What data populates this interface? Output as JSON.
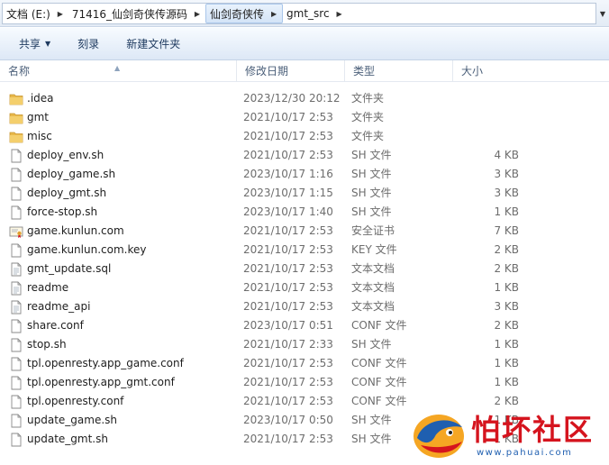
{
  "address_bar": {
    "crumbs": [
      {
        "label": "文档 (E:)"
      },
      {
        "label": "71416_仙剑奇侠传源码"
      },
      {
        "label": "仙剑奇侠传"
      },
      {
        "label": "gmt_src"
      }
    ]
  },
  "toolbar": {
    "organize_label": "共享",
    "burn_label": "刻录",
    "new_folder_label": "新建文件夹"
  },
  "columns": {
    "name": "名称",
    "date": "修改日期",
    "type": "类型",
    "size": "大小"
  },
  "files": [
    {
      "name": ".idea",
      "date": "2023/12/30 20:12",
      "type": "文件夹",
      "size": "",
      "icon": "folder-icon"
    },
    {
      "name": "gmt",
      "date": "2021/10/17 2:53",
      "type": "文件夹",
      "size": "",
      "icon": "folder-icon"
    },
    {
      "name": "misc",
      "date": "2021/10/17 2:53",
      "type": "文件夹",
      "size": "",
      "icon": "folder-icon"
    },
    {
      "name": "deploy_env.sh",
      "date": "2021/10/17 2:53",
      "type": "SH 文件",
      "size": "4 KB",
      "icon": "file-icon"
    },
    {
      "name": "deploy_game.sh",
      "date": "2023/10/17 1:16",
      "type": "SH 文件",
      "size": "3 KB",
      "icon": "file-icon"
    },
    {
      "name": "deploy_gmt.sh",
      "date": "2023/10/17 1:15",
      "type": "SH 文件",
      "size": "3 KB",
      "icon": "file-icon"
    },
    {
      "name": "force-stop.sh",
      "date": "2023/10/17 1:40",
      "type": "SH 文件",
      "size": "1 KB",
      "icon": "file-icon"
    },
    {
      "name": "game.kunlun.com",
      "date": "2021/10/17 2:53",
      "type": "安全证书",
      "size": "7 KB",
      "icon": "certificate-icon"
    },
    {
      "name": "game.kunlun.com.key",
      "date": "2021/10/17 2:53",
      "type": "KEY 文件",
      "size": "2 KB",
      "icon": "file-icon"
    },
    {
      "name": "gmt_update.sql",
      "date": "2021/10/17 2:53",
      "type": "文本文档",
      "size": "2 KB",
      "icon": "text-file-icon"
    },
    {
      "name": "readme",
      "date": "2021/10/17 2:53",
      "type": "文本文档",
      "size": "1 KB",
      "icon": "text-file-icon"
    },
    {
      "name": "readme_api",
      "date": "2021/10/17 2:53",
      "type": "文本文档",
      "size": "3 KB",
      "icon": "text-file-icon"
    },
    {
      "name": "share.conf",
      "date": "2023/10/17 0:51",
      "type": "CONF 文件",
      "size": "2 KB",
      "icon": "file-icon"
    },
    {
      "name": "stop.sh",
      "date": "2021/10/17 2:33",
      "type": "SH 文件",
      "size": "1 KB",
      "icon": "file-icon"
    },
    {
      "name": "tpl.openresty.app_game.conf",
      "date": "2021/10/17 2:53",
      "type": "CONF 文件",
      "size": "1 KB",
      "icon": "file-icon"
    },
    {
      "name": "tpl.openresty.app_gmt.conf",
      "date": "2021/10/17 2:53",
      "type": "CONF 文件",
      "size": "1 KB",
      "icon": "file-icon"
    },
    {
      "name": "tpl.openresty.conf",
      "date": "2021/10/17 2:53",
      "type": "CONF 文件",
      "size": "2 KB",
      "icon": "file-icon"
    },
    {
      "name": "update_game.sh",
      "date": "2023/10/17 0:50",
      "type": "SH 文件",
      "size": "1 KB",
      "icon": "file-icon"
    },
    {
      "name": "update_gmt.sh",
      "date": "2021/10/17 2:53",
      "type": "SH 文件",
      "size": "1 KB",
      "icon": "file-icon"
    }
  ],
  "watermark": {
    "text": "怕坏社区",
    "url": "www.pahuai.com"
  },
  "colors": {
    "folder": "#e8b84a",
    "toolbar_text": "#1e3a5f",
    "meta_text": "#6d6d6d",
    "watermark_red": "#d5141e",
    "watermark_blue": "#1f5fb0"
  }
}
